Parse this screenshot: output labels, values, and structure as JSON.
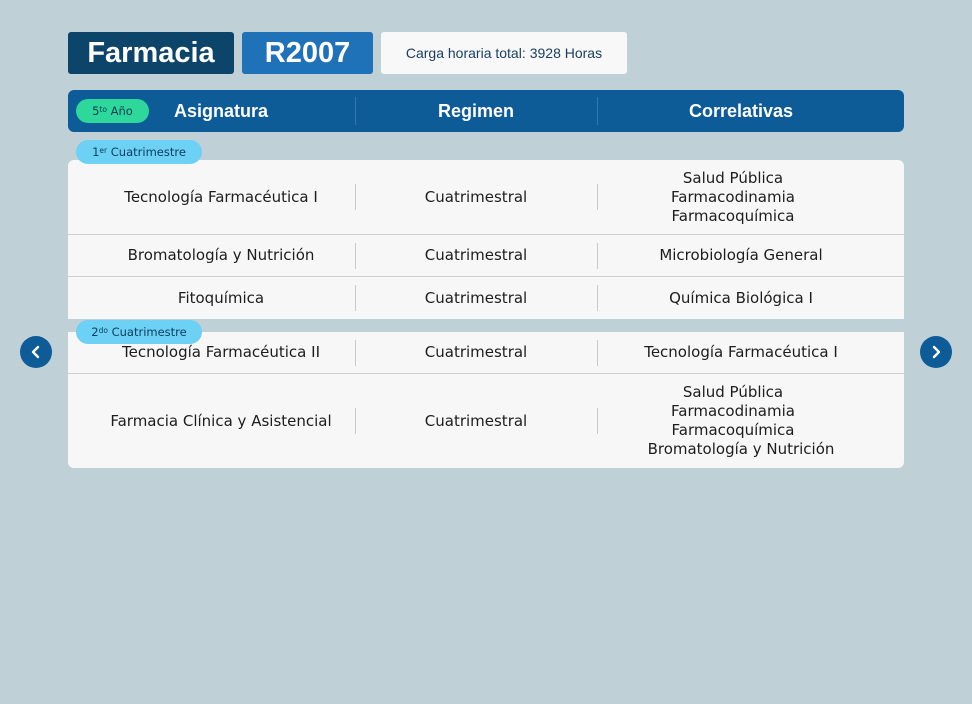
{
  "header": {
    "career": "Farmacia",
    "plan_code": "R2007",
    "hours_label": "Carga horaria total:",
    "hours_value": "3928 Horas"
  },
  "table": {
    "year_number": "5",
    "year_sup": "to",
    "year_word": "Año",
    "columns": [
      "Asignatura",
      "Regimen",
      "Correlativas"
    ]
  },
  "semesters": [
    {
      "number": "1",
      "sup": "er",
      "label": "Cuatrimestre",
      "rows": [
        {
          "subject": "Tecnología Farmacéutica I",
          "regime": "Cuatrimestral",
          "prereqs": [
            "Salud Pública",
            "Farmacodinamia",
            "Farmacoquímica"
          ]
        },
        {
          "subject": "Bromatología y Nutrición",
          "regime": "Cuatrimestral",
          "prereqs": [
            "Microbiología General"
          ]
        },
        {
          "subject": "Fitoquímica",
          "regime": "Cuatrimestral",
          "prereqs": [
            "Química Biológica I"
          ]
        }
      ]
    },
    {
      "number": "2",
      "sup": "do",
      "label": "Cuatrimestre",
      "rows": [
        {
          "subject": "Tecnología Farmacéutica II",
          "regime": "Cuatrimestral",
          "prereqs": [
            "Tecnología Farmacéutica I"
          ]
        },
        {
          "subject": "Farmacia Clínica y Asistencial",
          "regime": "Cuatrimestral",
          "prereqs": [
            "Salud Pública",
            "Farmacodinamia",
            "Farmacoquímica",
            "Bromatología y Nutrición"
          ]
        }
      ]
    }
  ],
  "nav": {
    "prev_icon": "chevron-left-icon",
    "next_icon": "chevron-right-icon",
    "color": "#0d5b97"
  }
}
